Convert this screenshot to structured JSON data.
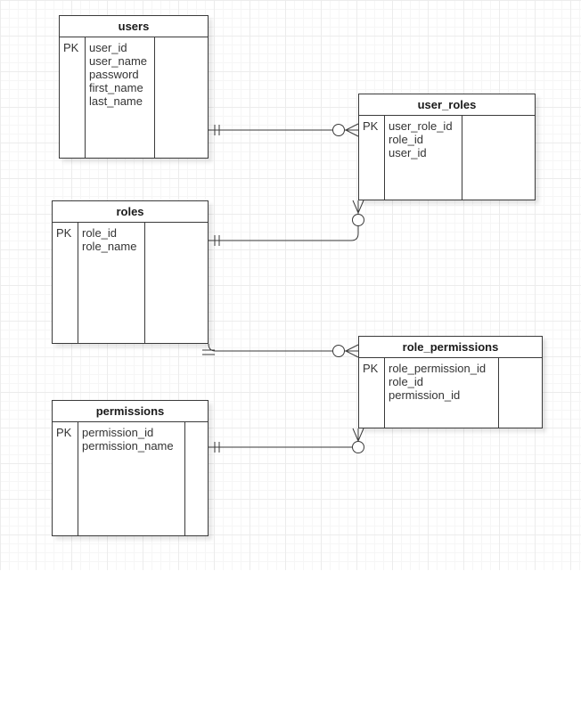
{
  "diagram": {
    "grid": true,
    "entities": [
      {
        "key": "users",
        "name": "users",
        "key_label": "PK",
        "fields": [
          "user_id",
          "user_name",
          "password",
          "first_name",
          "last_name"
        ]
      },
      {
        "key": "user_roles",
        "name": "user_roles",
        "key_label": "PK",
        "fields": [
          "user_role_id",
          "role_id",
          "user_id"
        ]
      },
      {
        "key": "roles",
        "name": "roles",
        "key_label": "PK",
        "fields": [
          "role_id",
          "role_name"
        ]
      },
      {
        "key": "role_permissions",
        "name": "role_permissions",
        "key_label": "PK",
        "fields": [
          "role_permission_id",
          "role_id",
          "permission_id"
        ]
      },
      {
        "key": "permissions",
        "name": "permissions",
        "key_label": "PK",
        "fields": [
          "permission_id",
          "permission_name"
        ]
      }
    ],
    "relationships": [
      {
        "from": "users",
        "to": "user_roles",
        "from_cardinality": "one-and-only-one",
        "to_cardinality": "zero-or-many"
      },
      {
        "from": "roles",
        "to": "user_roles",
        "from_cardinality": "one-and-only-one",
        "to_cardinality": "zero-or-many"
      },
      {
        "from": "roles",
        "to": "role_permissions",
        "from_cardinality": "one-and-only-one",
        "to_cardinality": "zero-or-many"
      },
      {
        "from": "permissions",
        "to": "role_permissions",
        "from_cardinality": "one-and-only-one",
        "to_cardinality": "zero-or-many"
      }
    ],
    "colors": {
      "line": "#3a3a3a",
      "background": "#ffffff",
      "grid": "#ececec"
    }
  }
}
